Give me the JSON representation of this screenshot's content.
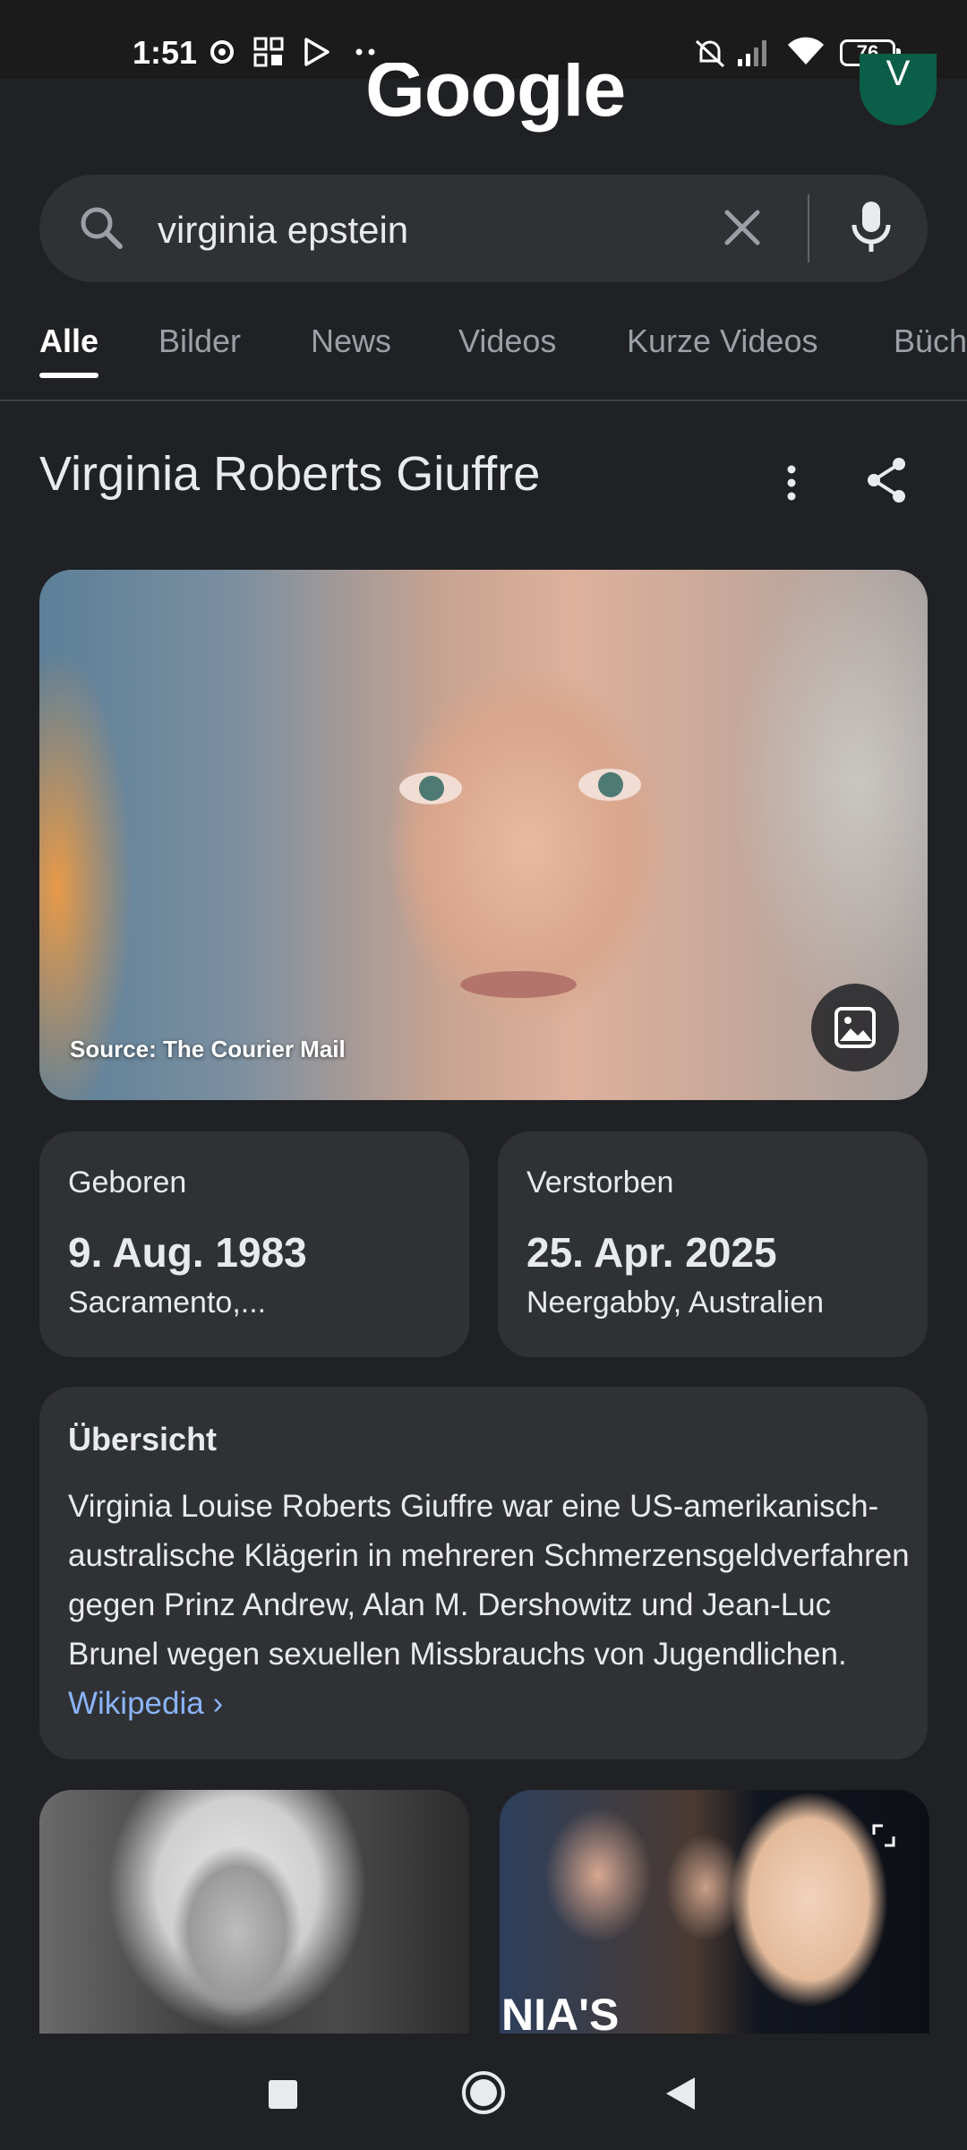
{
  "status_bar": {
    "time": "1:51",
    "battery": "76"
  },
  "header": {
    "logo": "Google",
    "avatar_initial": "V"
  },
  "search": {
    "query": "virginia epstein"
  },
  "tabs": [
    {
      "label": "Alle",
      "active": true
    },
    {
      "label": "Bilder"
    },
    {
      "label": "News"
    },
    {
      "label": "Videos"
    },
    {
      "label": "Kurze Videos"
    },
    {
      "label": "Büch"
    }
  ],
  "knowledge_panel": {
    "title": "Virginia Roberts Giuffre",
    "hero_image": {
      "source": "Source: The Courier Mail"
    },
    "facts": [
      {
        "label": "Geboren",
        "value": "9. Aug. 1983",
        "sub": "Sacramento,..."
      },
      {
        "label": "Verstorben",
        "value": "25. Apr. 2025",
        "sub": "Neergabby, Australien"
      }
    ],
    "overview": {
      "heading": "Übersicht",
      "text": "Virginia Louise Roberts Giuffre war eine US-amerikanisch-australische Klägerin in mehreren Schmerzensgeldverfahren gegen Prinz Andrew, Alan M. Dershowitz und Jean-Luc Brunel wegen sexuellen Missbrauchs von Jugendlichen.",
      "link": "Wikipedia ›"
    },
    "thumbnails": [
      {
        "caption": ""
      },
      {
        "caption": "NIA'S"
      }
    ]
  },
  "colors": {
    "background": "#202124",
    "card": "#303134",
    "link": "#8ab4f8",
    "avatar": "#0b5e47"
  }
}
